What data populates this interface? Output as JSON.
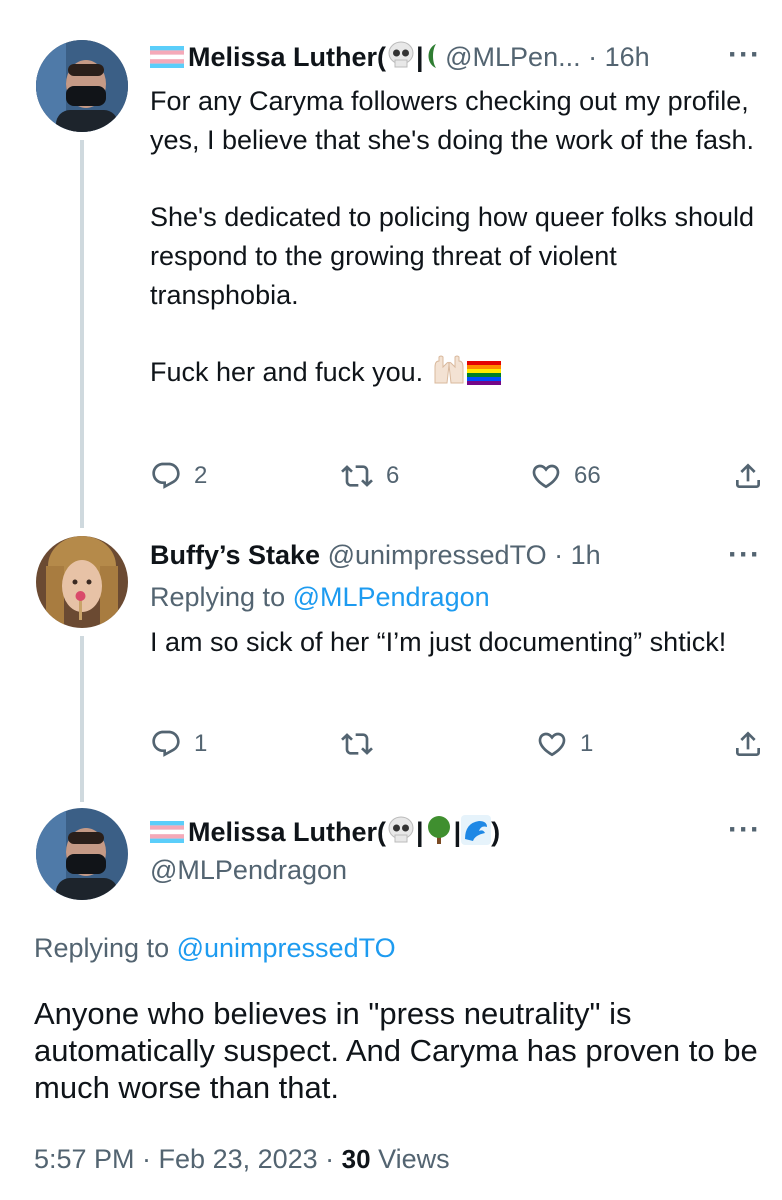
{
  "tweet1": {
    "name": "Melissa Luther(",
    "handle": "@MLPen...",
    "time": "· 16h",
    "paragraphs": [
      "For any Caryma followers checking out my profile, yes, I believe that she's doing the work of the fash.",
      "She's dedicated to policing how queer folks should respond to the growing threat of violent transphobia.",
      "Fuck her and fuck you."
    ],
    "replies": "2",
    "retweets": "6",
    "likes": "66"
  },
  "tweet2": {
    "name": "Buffy’s Stake",
    "handle": "@unimpressedTO",
    "time": "· 1h",
    "replying_prefix": "Replying to ",
    "replying_handle": "@MLPendragon",
    "text": "I am so sick of her “I’m just documenting” shtick!",
    "replies": "1",
    "retweets": "",
    "likes": "1"
  },
  "tweet3": {
    "name": "Melissa Luther(",
    "name_close": ")",
    "handle": "@MLPendragon",
    "replying_prefix": "Replying to ",
    "replying_handle": "@unimpressedTO",
    "text": "Anyone who believes in \"press neutrality\" is automatically suspect. And Caryma has proven to be much worse than that.",
    "timestamp": "5:57 PM · Feb 23, 2023 · ",
    "views_count": "30",
    "views_label": " Views"
  },
  "icons": {
    "more": "more-icon",
    "reply": "reply-icon",
    "retweet": "retweet-icon",
    "like": "heart-icon",
    "share": "share-icon"
  },
  "colors": {
    "link": "#1d9bf0",
    "secondary": "#536471",
    "text": "#0f1419"
  }
}
